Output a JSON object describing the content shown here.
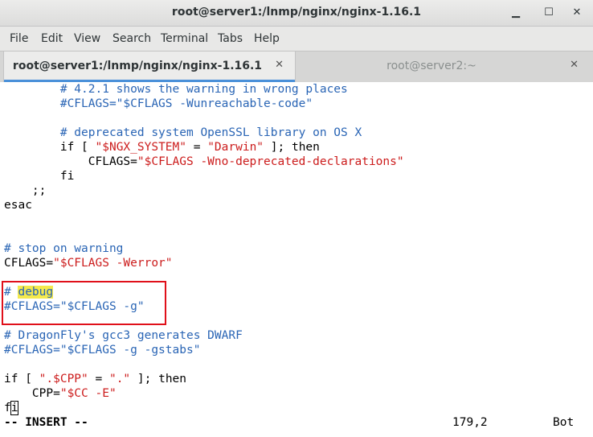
{
  "window": {
    "title": "root@server1:/lnmp/nginx/nginx-1.16.1"
  },
  "menu": [
    "File",
    "Edit",
    "View",
    "Search",
    "Terminal",
    "Tabs",
    "Help"
  ],
  "tabs": [
    {
      "label": "root@server1:/lnmp/nginx/nginx-1.16.1",
      "active": true
    },
    {
      "label": "root@server2:~",
      "active": false
    }
  ],
  "editor": {
    "lines": [
      [
        {
          "t": "        "
        },
        {
          "t": "# 4.2.1 shows the warning in wrong places",
          "k": "c"
        }
      ],
      [
        {
          "t": "        "
        },
        {
          "t": "#CFLAGS=\"$CFLAGS -Wunreachable-code\"",
          "k": "c"
        }
      ],
      [],
      [
        {
          "t": "        "
        },
        {
          "t": "# deprecated system OpenSSL library on OS X",
          "k": "c"
        }
      ],
      [
        {
          "t": "        if [ "
        },
        {
          "t": "\"$NGX_SYSTEM\"",
          "k": "s"
        },
        {
          "t": " = "
        },
        {
          "t": "\"Darwin\"",
          "k": "s"
        },
        {
          "t": " ]; then"
        }
      ],
      [
        {
          "t": "            CFLAGS="
        },
        {
          "t": "\"$CFLAGS -Wno-deprecated-declarations\"",
          "k": "s"
        }
      ],
      [
        {
          "t": "        fi"
        }
      ],
      [
        {
          "t": "    ;;"
        }
      ],
      [
        {
          "t": "esac"
        }
      ],
      [],
      [],
      [
        {
          "t": "# stop on warning",
          "k": "c"
        }
      ],
      [
        {
          "t": "CFLAGS="
        },
        {
          "t": "\"$CFLAGS -Werror\"",
          "k": "s"
        }
      ],
      [],
      [
        {
          "t": "# ",
          "k": "c"
        },
        {
          "t": "debug",
          "k": "c hl"
        }
      ],
      [
        {
          "t": "#CFLAGS=\"$CFLAGS -g\"",
          "k": "c"
        }
      ],
      [],
      [
        {
          "t": "# DragonFly's gcc3 generates DWARF",
          "k": "c"
        }
      ],
      [
        {
          "t": "#CFLAGS=\"$CFLAGS -g -gstabs\"",
          "k": "c"
        }
      ],
      [],
      [
        {
          "t": "if [ "
        },
        {
          "t": "\".$CPP\"",
          "k": "s"
        },
        {
          "t": " = "
        },
        {
          "t": "\".\"",
          "k": "s"
        },
        {
          "t": " ]; then"
        }
      ],
      [
        {
          "t": "    CPP="
        },
        {
          "t": "\"$CC -E\"",
          "k": "s"
        }
      ],
      [
        {
          "t": "f"
        },
        {
          "t": "i",
          "k": "cursor"
        }
      ]
    ]
  },
  "status": {
    "mode": "-- INSERT --",
    "position": "179,2",
    "scroll": "Bot"
  }
}
